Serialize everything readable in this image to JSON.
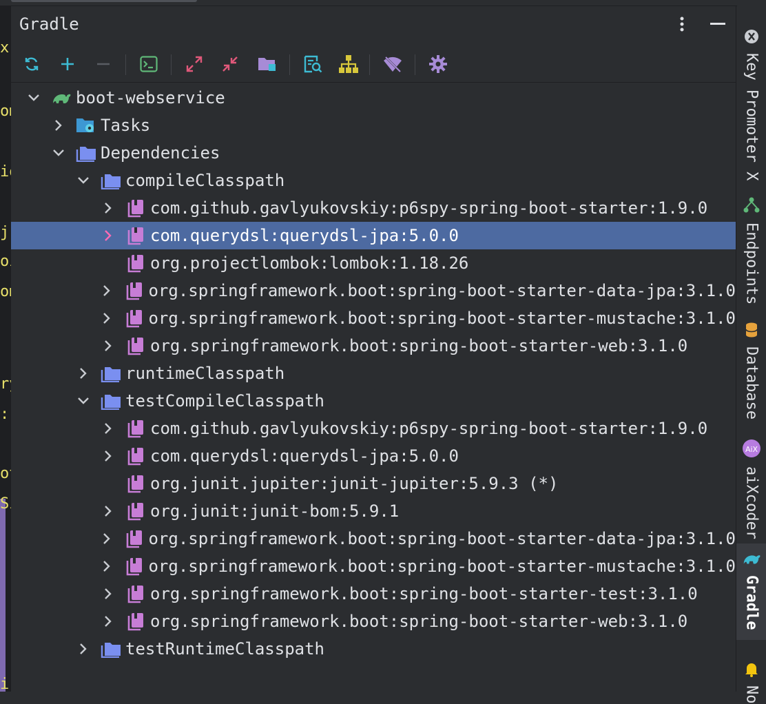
{
  "panel": {
    "title": "Gradle"
  },
  "editor_fragments": [
    "x",
    "om",
    "io",
    "j",
    "oi",
    "om",
    "ry",
    "::",
    "ot",
    "Si",
    "i"
  ],
  "toolbar": [
    {
      "name": "reload-icon",
      "color": "#3dbbd3"
    },
    {
      "name": "add-icon",
      "color": "#3dbbd3"
    },
    {
      "name": "remove-icon",
      "color": "#5a5d63"
    },
    {
      "name": "terminal-icon",
      "color": "#5fb878"
    },
    {
      "name": "expand-all-icon",
      "color": "#e0587a"
    },
    {
      "name": "collapse-all-icon",
      "color": "#e0587a"
    },
    {
      "name": "folder-offline-icon",
      "color": "#a78bd6"
    },
    {
      "name": "analyze-dependencies-icon",
      "color": "#3dbbd3"
    },
    {
      "name": "dependency-diagram-icon",
      "color": "#d8c73b"
    },
    {
      "name": "toggle-offline-icon",
      "color": "#a78bd6"
    },
    {
      "name": "settings-icon",
      "color": "#a78bd6"
    }
  ],
  "tree": [
    {
      "level": 0,
      "expanded": true,
      "icon": "gradle",
      "label": "boot-webservice"
    },
    {
      "level": 1,
      "expanded": false,
      "icon": "tasks",
      "label": "Tasks"
    },
    {
      "level": 1,
      "expanded": true,
      "icon": "folder",
      "label": "Dependencies"
    },
    {
      "level": 2,
      "expanded": true,
      "icon": "folder",
      "label": "compileClasspath"
    },
    {
      "level": 3,
      "expanded": false,
      "icon": "lib",
      "label": "com.github.gavlyukovskiy:p6spy-spring-boot-starter:1.9.0"
    },
    {
      "level": 3,
      "expanded": false,
      "icon": "lib",
      "label": "com.querydsl:querydsl-jpa:5.0.0",
      "selected": true
    },
    {
      "level": 3,
      "leaf": true,
      "icon": "lib",
      "label": "org.projectlombok:lombok:1.18.26"
    },
    {
      "level": 3,
      "expanded": false,
      "icon": "lib",
      "label": "org.springframework.boot:spring-boot-starter-data-jpa:3.1.0"
    },
    {
      "level": 3,
      "expanded": false,
      "icon": "lib",
      "label": "org.springframework.boot:spring-boot-starter-mustache:3.1.0"
    },
    {
      "level": 3,
      "expanded": false,
      "icon": "lib",
      "label": "org.springframework.boot:spring-boot-starter-web:3.1.0"
    },
    {
      "level": 2,
      "expanded": false,
      "icon": "folder",
      "label": "runtimeClasspath"
    },
    {
      "level": 2,
      "expanded": true,
      "icon": "folder",
      "label": "testCompileClasspath"
    },
    {
      "level": 3,
      "expanded": false,
      "icon": "lib",
      "label": "com.github.gavlyukovskiy:p6spy-spring-boot-starter:1.9.0"
    },
    {
      "level": 3,
      "expanded": false,
      "icon": "lib",
      "label": "com.querydsl:querydsl-jpa:5.0.0"
    },
    {
      "level": 3,
      "leaf": true,
      "icon": "lib",
      "label": "org.junit.jupiter:junit-jupiter:5.9.3 (*)"
    },
    {
      "level": 3,
      "expanded": false,
      "icon": "lib",
      "label": "org.junit:junit-bom:5.9.1"
    },
    {
      "level": 3,
      "expanded": false,
      "icon": "lib",
      "label": "org.springframework.boot:spring-boot-starter-data-jpa:3.1.0"
    },
    {
      "level": 3,
      "expanded": false,
      "icon": "lib",
      "label": "org.springframework.boot:spring-boot-starter-mustache:3.1.0"
    },
    {
      "level": 3,
      "expanded": false,
      "icon": "lib",
      "label": "org.springframework.boot:spring-boot-starter-test:3.1.0"
    },
    {
      "level": 3,
      "expanded": false,
      "icon": "lib",
      "label": "org.springframework.boot:spring-boot-starter-web:3.1.0"
    },
    {
      "level": 2,
      "expanded": false,
      "icon": "folder",
      "label": "testRuntimeClasspath"
    }
  ],
  "right_stripe": [
    {
      "label": "Key Promoter X",
      "icon": "key-promoter-icon"
    },
    {
      "label": "Endpoints",
      "icon": "endpoints-icon"
    },
    {
      "label": "Database",
      "icon": "database-icon"
    },
    {
      "label": "aiXcoder",
      "icon": "aixcoder-icon"
    },
    {
      "label": "Gradle",
      "icon": "gradle-icon",
      "active": true
    },
    {
      "label": "No",
      "icon": "notifications-icon"
    }
  ],
  "colors": {
    "accent": "#4d6aa1",
    "folder": "#7a8ff0",
    "library": "#c77dd6",
    "gradle": "#5fb878",
    "selected_chevron": "#ff6bb5"
  }
}
